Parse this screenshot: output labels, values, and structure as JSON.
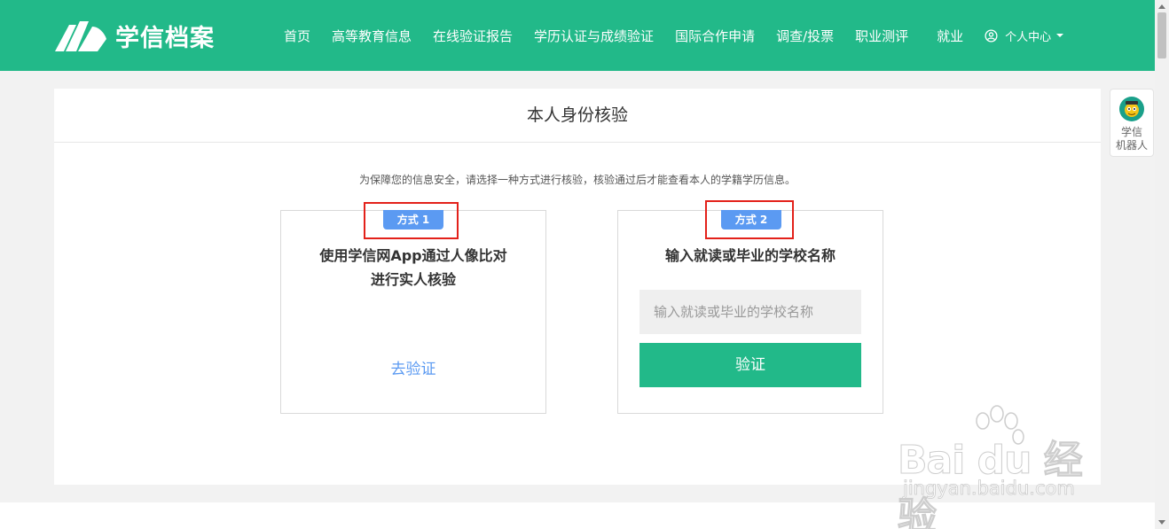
{
  "header": {
    "logo_text": "学信档案",
    "nav": [
      {
        "label": "首页"
      },
      {
        "label": "高等教育信息"
      },
      {
        "label": "在线验证报告"
      },
      {
        "label": "学历认证与成绩验证"
      },
      {
        "label": "国际合作申请"
      },
      {
        "label": "调查/投票"
      },
      {
        "label": "职业测评"
      },
      {
        "label": "就业"
      }
    ],
    "user_center": "个人中心"
  },
  "main": {
    "title": "本人身份核验",
    "intro": "为保障您的信息安全，请选择一种方式进行核验，核验通过后才能查看本人的学籍学历信息。",
    "option1": {
      "badge": "方式 1",
      "title_line1": "使用学信网App通过人像比对",
      "title_line2": "进行实人核验",
      "link": "去验证"
    },
    "option2": {
      "badge": "方式 2",
      "title": "输入就读或毕业的学校名称",
      "input_placeholder": "输入就读或毕业的学校名称",
      "input_value": "",
      "button": "验证"
    }
  },
  "robot": {
    "line1": "学信",
    "line2": "机器人"
  },
  "watermark": {
    "brand": "Bai du 经验",
    "url": "jingyan.baidu.com"
  },
  "colors": {
    "header": "#22b989",
    "accent_blue": "#5b9af2",
    "highlight_red": "#e3211a"
  }
}
